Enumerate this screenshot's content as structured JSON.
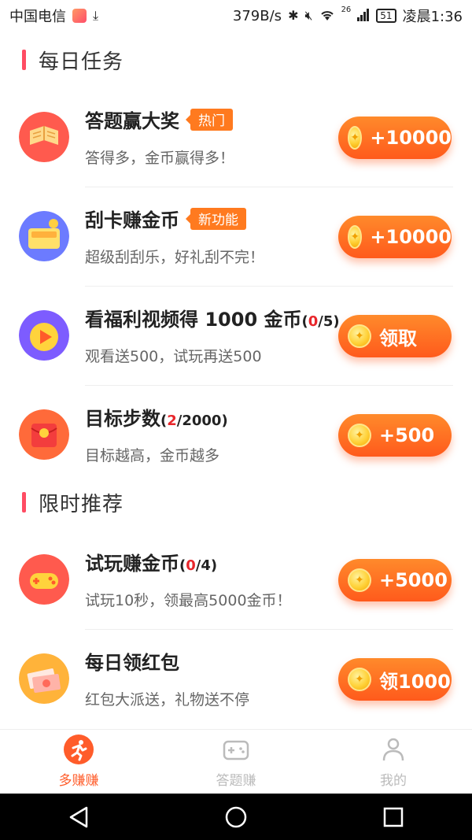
{
  "status_bar": {
    "carrier": "中国电信",
    "speed": "379B/s",
    "network": "26",
    "battery": "51",
    "time": "凌晨1:36"
  },
  "sections": [
    {
      "title": "每日任务",
      "tasks": [
        {
          "title": "答题赢大奖",
          "badge": "热门",
          "subtitle": "答得多，金币赢得多！",
          "reward": "+10000"
        },
        {
          "title": "刮卡赚金币",
          "badge": "新功能",
          "subtitle": "超级刮刮乐，好礼刮不完！",
          "reward": "+10000"
        },
        {
          "title": "看福利视频得 1000 金币",
          "progress_current": "0",
          "progress_total": "/5",
          "subtitle": "观看送500，试玩再送500",
          "reward": "领取"
        },
        {
          "title": "目标步数",
          "progress_current": "2",
          "progress_total": "/2000",
          "subtitle": "目标越高，金币越多",
          "reward": "+500"
        }
      ]
    },
    {
      "title": "限时推荐",
      "tasks": [
        {
          "title": "试玩赚金币",
          "progress_current": "0",
          "progress_total": "/4",
          "subtitle": "试玩10秒，领最高5000金币！",
          "reward": "+5000"
        },
        {
          "title": "每日领红包",
          "subtitle": "红包大派送，礼物送不停",
          "reward": "领1000"
        }
      ]
    }
  ],
  "tabs": [
    {
      "label": "多赚赚",
      "active": true
    },
    {
      "label": "答题赚",
      "active": false
    },
    {
      "label": "我的",
      "active": false
    }
  ],
  "colors": {
    "accent": "#ff5c2a",
    "section_bar": "#ff4c63",
    "badge": "#ff7a1f",
    "progress_highlight": "#e8262b"
  }
}
